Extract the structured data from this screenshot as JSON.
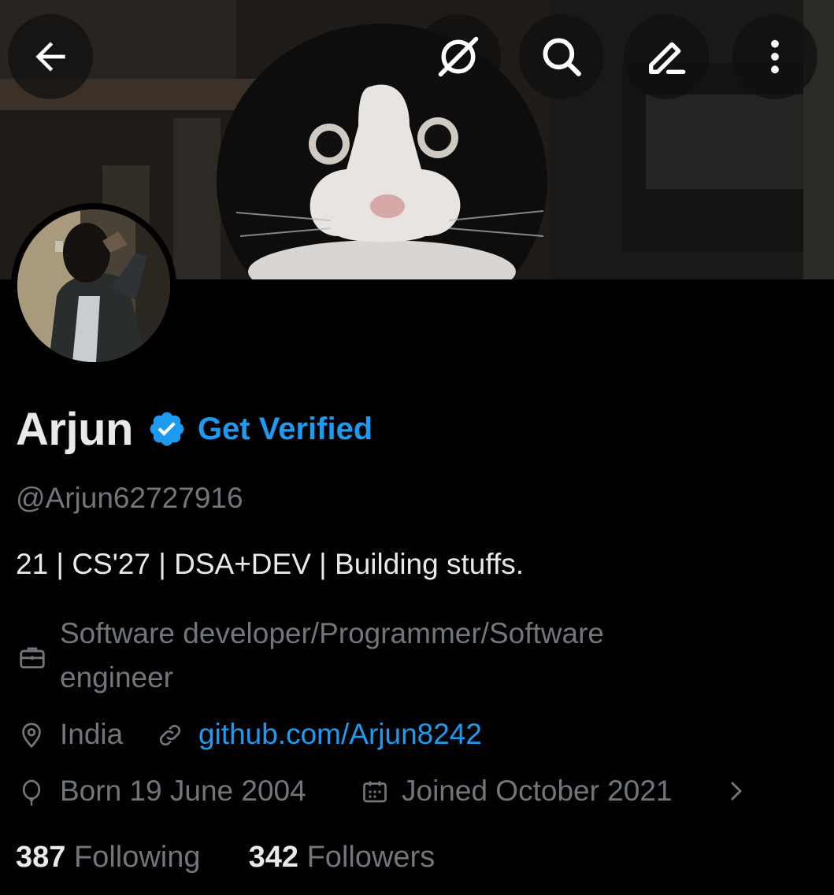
{
  "header": {
    "back_icon": "arrow-left-icon",
    "grok_icon": "grok-icon",
    "search_icon": "search-icon",
    "edit_icon": "pencil-icon",
    "more_icon": "more-vertical-icon"
  },
  "profile": {
    "name": "Arjun",
    "get_verified": "Get Verified",
    "handle": "@Arjun62727916",
    "bio": "21 | CS'27 | DSA+DEV | Building stuffs.",
    "profession_line1": "Software developer/Programmer/Software",
    "profession_line2": "engineer",
    "location": "India",
    "website": "github.com/Arjun8242",
    "birthday": "Born 19 June 2004",
    "joined": "Joined October 2021",
    "following_count": "387",
    "following_label": "Following",
    "followers_count": "342",
    "followers_label": "Followers"
  },
  "colors": {
    "accent": "#1d9bf0",
    "secondary_text": "#71767b",
    "primary_text": "#e7e9ea",
    "background": "#000000"
  }
}
